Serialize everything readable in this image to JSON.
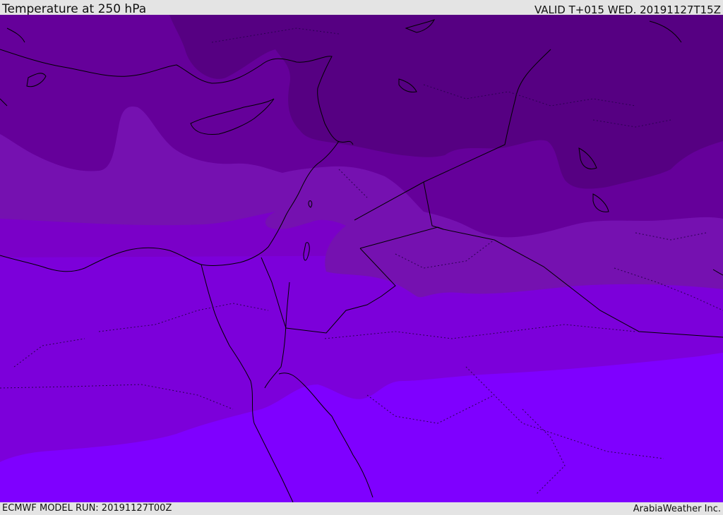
{
  "header": {
    "title": "Temperature at 250 hPa",
    "valid_time": "VALID T+015 WED. 20191127T15Z"
  },
  "footer": {
    "model_run": "ECMWF MODEL RUN: 20191127T00Z",
    "credit": "ArabiaWeather Inc."
  },
  "map": {
    "field": "Temperature at 250 hPa",
    "colors": {
      "band_darkest": "#560082",
      "band_dark": "#65009a",
      "band_mid_dark": "#7511b0",
      "band_mid": "#7a00c8",
      "band_mid_light": "#7c00da",
      "band_lightest": "#7f00ff",
      "coastline": "#000000",
      "borders": "#2a0050"
    }
  }
}
